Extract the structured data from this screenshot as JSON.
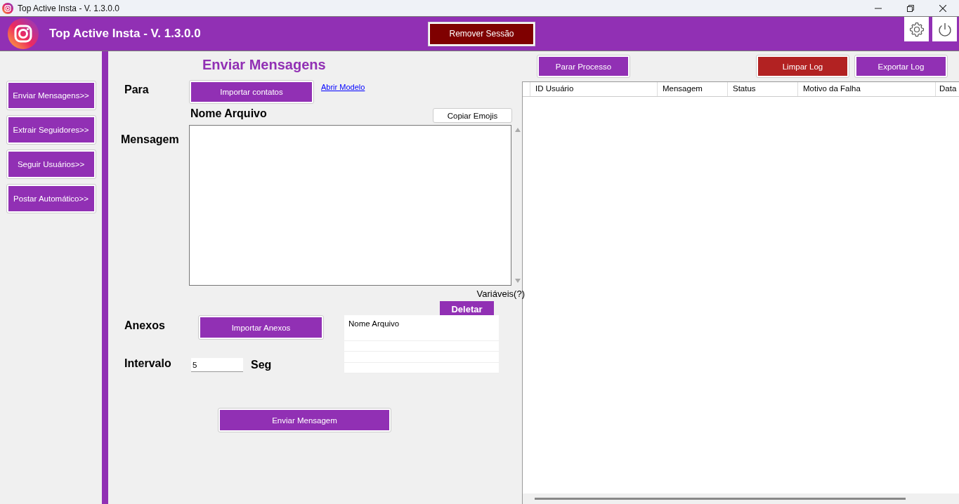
{
  "window": {
    "title": "Top Active Insta - V. 1.3.0.0"
  },
  "header": {
    "title": "Top Active Insta - V. 1.3.0.0",
    "session_button": "Remover Sessão"
  },
  "sidebar": {
    "items": [
      {
        "label": "Enviar Mensagens>>"
      },
      {
        "label": "Extrair Seguidores>>"
      },
      {
        "label": "Seguir Usuários>>"
      },
      {
        "label": "Postar Automático>>"
      }
    ]
  },
  "form": {
    "title": "Enviar Mensagens",
    "to_label": "Para",
    "import_contacts": "Importar contatos",
    "template_link": "Abrir Modelo",
    "file_name": "Nome Arquivo",
    "copy_emojis": "Copiar Emojis",
    "message_label": "Mensagem",
    "variables": "Variáveis(?)",
    "delete_button": "Deletar",
    "attachments_label": "Anexos",
    "import_attachments": "Importar Anexos",
    "attachments_column": "Nome Arquivo",
    "interval_label": "Intervalo",
    "interval_value": "5",
    "interval_unit": "Seg",
    "send_button": "Enviar Mensagem"
  },
  "log": {
    "stop_button": "Parar Processo",
    "clear_button": "Limpar Log",
    "export_button": "Exportar Log",
    "columns": [
      "ID Usuário",
      "Mensagem",
      "Status",
      "Motivo da Falha",
      "Data"
    ]
  }
}
